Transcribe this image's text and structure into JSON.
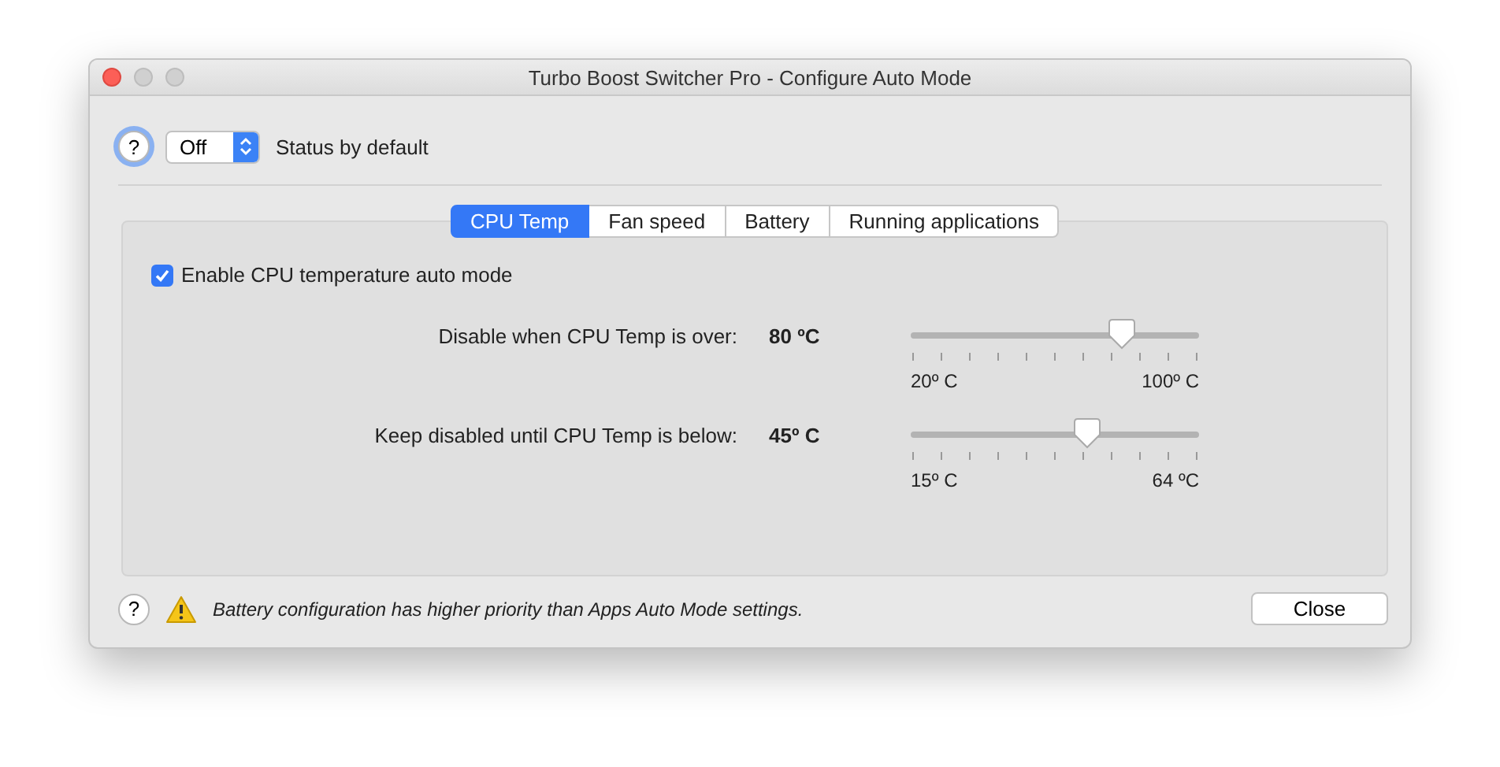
{
  "window": {
    "title": "Turbo Boost Switcher Pro - Configure Auto Mode"
  },
  "help_buttons": [
    "?",
    "?"
  ],
  "default_status": {
    "value": "Off",
    "label": "Status by default"
  },
  "tabs": [
    {
      "label": "CPU Temp",
      "selected": true
    },
    {
      "label": "Fan speed",
      "selected": false
    },
    {
      "label": "Battery",
      "selected": false
    },
    {
      "label": "Running applications",
      "selected": false
    }
  ],
  "enable_checkbox": {
    "label": "Enable CPU temperature auto mode",
    "checked": true
  },
  "sliders": [
    {
      "label": "Disable when CPU Temp is over:",
      "reading": "80 ºC",
      "level": 0.73,
      "min_label": "20º C",
      "max_label": "100º C"
    },
    {
      "label": "Keep disabled until CPU Temp is below:",
      "reading": "45º C",
      "level": 0.61,
      "min_label": "15º C",
      "max_label": "64 ºC"
    }
  ],
  "footer": {
    "note": "Battery configuration has higher priority than Apps Auto Mode settings.",
    "button": "Close"
  }
}
